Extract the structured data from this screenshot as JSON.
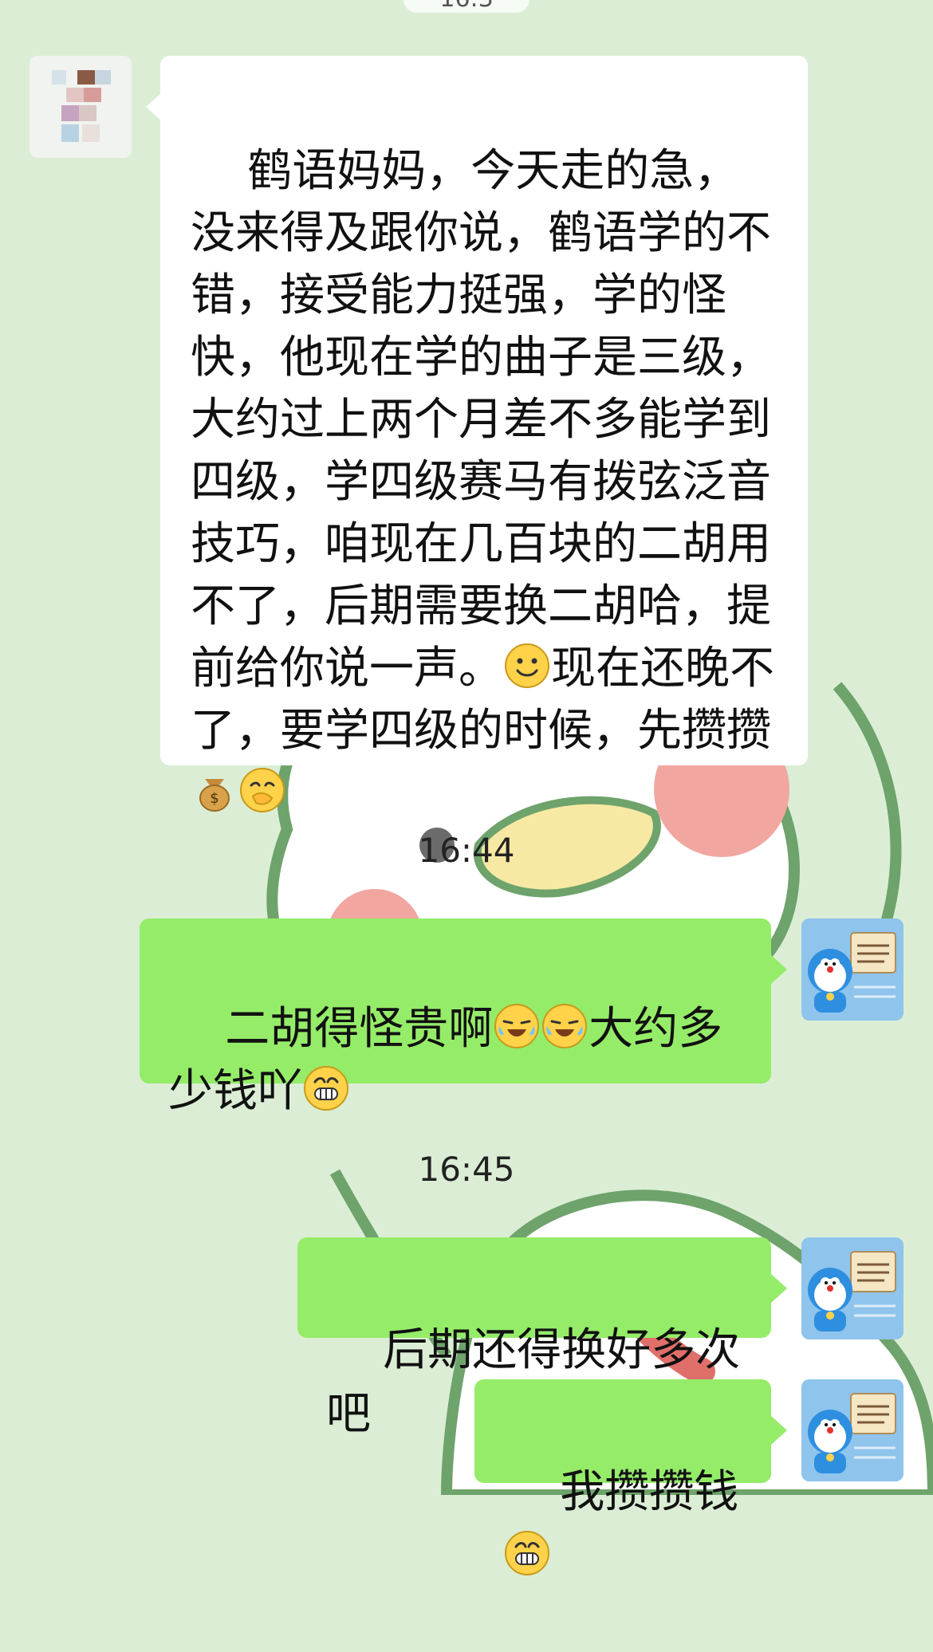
{
  "chat": {
    "top_time_partial": "16:3",
    "messages": [
      {
        "id": "m1",
        "direction": "incoming",
        "text": "鹤语妈妈，今天走的急，没来得及跟你说，鹤语学的不错，接受能力挺强，学的怪快，他现在学的曲子是三级，大约过上两个月差不多能学到四级，学四级赛马有拨弦泛音技巧，咱现在几百块的二胡用不了，后期需要换二胡哈，提前给你说一声。",
        "text_after_smile": "现在还晚不了，要学四级的时候，先攒攒",
        "emojis": [
          "smile-emoji",
          "money-bag-emoji",
          "hand-over-mouth-emoji"
        ]
      },
      {
        "id": "t1",
        "time": "16:44"
      },
      {
        "id": "m2",
        "direction": "outgoing",
        "text_part1": "二胡得怪贵啊",
        "text_part2": "大约多少钱吖",
        "emojis": [
          "crying-laughing-emoji",
          "crying-laughing-emoji",
          "grin-emoji"
        ]
      },
      {
        "id": "t2",
        "time": "16:45"
      },
      {
        "id": "m3",
        "direction": "outgoing",
        "text": "后期还得换好多次吧"
      },
      {
        "id": "m4",
        "direction": "outgoing",
        "text": "我攒攒钱",
        "emojis": [
          "grin-emoji"
        ]
      }
    ]
  },
  "theme": {
    "background": "#dbeed5",
    "incoming_bubble": "#ffffff",
    "outgoing_bubble": "#95ec69"
  }
}
